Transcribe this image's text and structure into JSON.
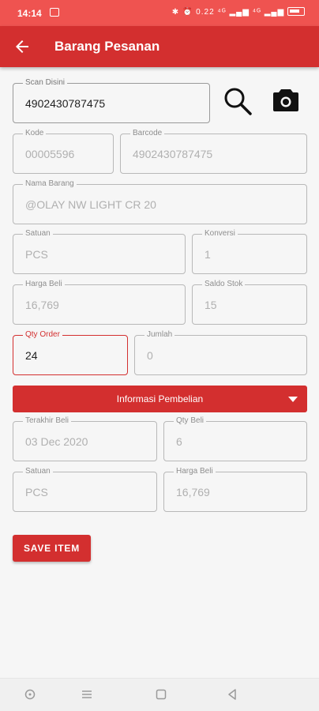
{
  "status_bar": {
    "time": "14:14",
    "indicators": "✱ ⏰ 0.22 ⁴ᴳ ▂▄▆ ⁴ᴳ ▂▄▆",
    "battery": "battery-icon"
  },
  "app_bar": {
    "title": "Barang Pesanan",
    "back_icon": "arrow-left-icon"
  },
  "form": {
    "scan": {
      "label": "Scan Disini",
      "value": "4902430787475"
    },
    "kode": {
      "label": "Kode",
      "value": "00005596"
    },
    "barcode": {
      "label": "Barcode",
      "value": "4902430787475"
    },
    "nama_barang": {
      "label": "Nama Barang",
      "value": "@OLAY NW LIGHT CR 20"
    },
    "satuan": {
      "label": "Satuan",
      "value": "PCS"
    },
    "konversi": {
      "label": "Konversi",
      "value": "1"
    },
    "harga_beli": {
      "label": "Harga Beli",
      "value": "16,769"
    },
    "saldo_stok": {
      "label": "Saldo Stok",
      "value": "15"
    },
    "qty_order": {
      "label": "Qty Order",
      "value": "24"
    },
    "jumlah": {
      "label": "Jumlah",
      "value": "0"
    }
  },
  "purchase_info": {
    "toggle_label": "Informasi Pembelian",
    "terakhir_beli": {
      "label": "Terakhir Beli",
      "value": "03 Dec 2020"
    },
    "qty_beli": {
      "label": "Qty Beli",
      "value": "6"
    },
    "satuan": {
      "label": "Satuan",
      "value": "PCS"
    },
    "harga_beli": {
      "label": "Harga Beli",
      "value": "16,769"
    }
  },
  "actions": {
    "save_label": "SAVE ITEM"
  },
  "icons": [
    "search-icon",
    "camera-icon",
    "chevron-down-icon",
    "home-icon",
    "menu-icon",
    "overview-icon",
    "back-triangle-icon"
  ],
  "colors": {
    "primary": "#d32f2f",
    "status_bar": "#ef5350",
    "background": "#f6f6f6"
  }
}
